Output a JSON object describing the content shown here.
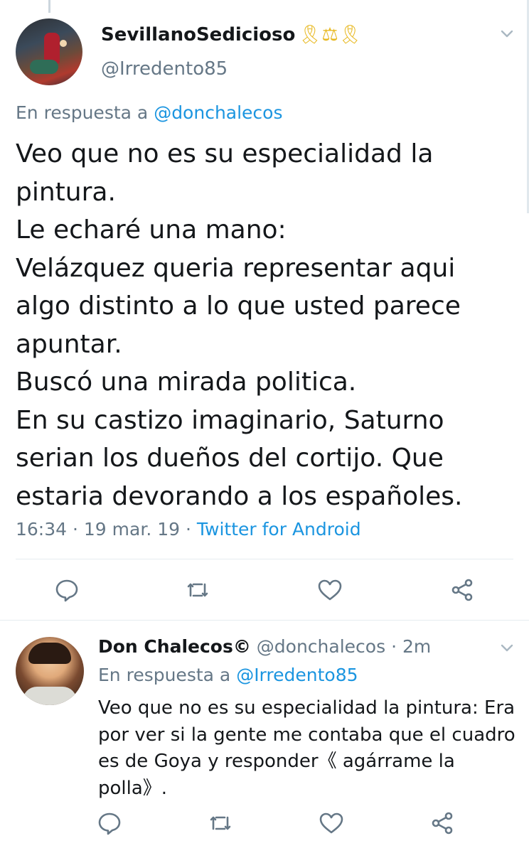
{
  "main_tweet": {
    "name": "SevillanoSedicioso",
    "name_emojis": "🎗⚖🎗",
    "handle": "@Irredento85",
    "reply_prefix": "En respuesta a",
    "reply_mention": "@donchalecos",
    "text_lines": [
      "Veo que no es su especialidad la",
      "pintura.",
      "Le echaré una mano:",
      "Velázquez queria representar aqui",
      "algo distinto a lo que usted parece",
      "apuntar.",
      "Buscó una mirada politica.",
      "En su castizo imaginario, Saturno",
      "serian los dueños del cortijo. Que",
      "estaria devorando a los españoles."
    ],
    "time": "16:34",
    "date": "19 mar. 19",
    "separator": "·",
    "source": "Twitter for Android"
  },
  "reply_tweet": {
    "name": "Don Chalecos©",
    "handle": "@donchalecos",
    "separator": "·",
    "age": "2m",
    "reply_prefix": "En respuesta a",
    "reply_mention": "@Irredento85",
    "text_lines": [
      "Veo que no es su especialidad la pintura: Era",
      "por ver si la gente me contaba que el cuadro",
      "es de Goya y responder《 agárrame la",
      "polla》."
    ]
  },
  "icons": {
    "reply": "comment-icon",
    "retweet": "retweet-icon",
    "like": "heart-icon",
    "share": "share-icon",
    "menu": "chevron-down-icon"
  },
  "colors": {
    "text": "#14171a",
    "secondary": "#657786",
    "link": "#1b95e0",
    "divider": "#e6ecf0"
  }
}
